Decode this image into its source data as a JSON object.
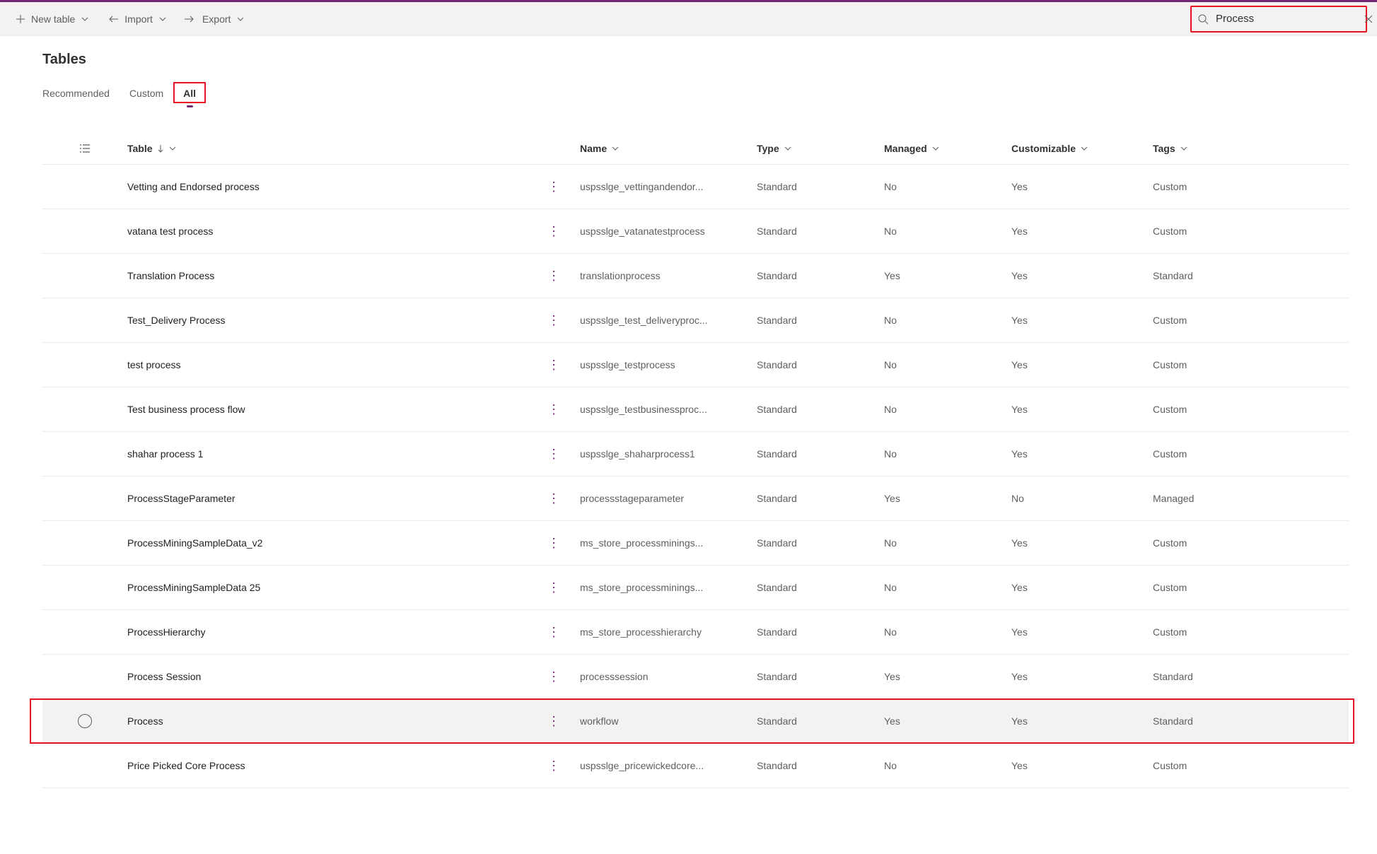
{
  "toolbar": {
    "new_table": "New table",
    "import": "Import",
    "export": "Export"
  },
  "search": {
    "value": "Process"
  },
  "page_title": "Tables",
  "tabs": [
    {
      "label": "Recommended",
      "active": false
    },
    {
      "label": "Custom",
      "active": false
    },
    {
      "label": "All",
      "active": true
    }
  ],
  "columns": {
    "table": "Table",
    "name": "Name",
    "type": "Type",
    "managed": "Managed",
    "customizable": "Customizable",
    "tags": "Tags"
  },
  "rows": [
    {
      "table": "Vetting and Endorsed process",
      "name": "uspsslge_vettingandendor...",
      "type": "Standard",
      "managed": "No",
      "customizable": "Yes",
      "tags": "Custom",
      "highlight": false,
      "selected": false
    },
    {
      "table": "vatana test process",
      "name": "uspsslge_vatanatestprocess",
      "type": "Standard",
      "managed": "No",
      "customizable": "Yes",
      "tags": "Custom",
      "highlight": false,
      "selected": false
    },
    {
      "table": "Translation Process",
      "name": "translationprocess",
      "type": "Standard",
      "managed": "Yes",
      "customizable": "Yes",
      "tags": "Standard",
      "highlight": false,
      "selected": false
    },
    {
      "table": "Test_Delivery Process",
      "name": "uspsslge_test_deliveryproc...",
      "type": "Standard",
      "managed": "No",
      "customizable": "Yes",
      "tags": "Custom",
      "highlight": false,
      "selected": false
    },
    {
      "table": "test process",
      "name": "uspsslge_testprocess",
      "type": "Standard",
      "managed": "No",
      "customizable": "Yes",
      "tags": "Custom",
      "highlight": false,
      "selected": false
    },
    {
      "table": "Test business process flow",
      "name": "uspsslge_testbusinessproc...",
      "type": "Standard",
      "managed": "No",
      "customizable": "Yes",
      "tags": "Custom",
      "highlight": false,
      "selected": false
    },
    {
      "table": "shahar process 1",
      "name": "uspsslge_shaharprocess1",
      "type": "Standard",
      "managed": "No",
      "customizable": "Yes",
      "tags": "Custom",
      "highlight": false,
      "selected": false
    },
    {
      "table": "ProcessStageParameter",
      "name": "processstageparameter",
      "type": "Standard",
      "managed": "Yes",
      "customizable": "No",
      "tags": "Managed",
      "highlight": false,
      "selected": false
    },
    {
      "table": "ProcessMiningSampleData_v2",
      "name": "ms_store_processminings...",
      "type": "Standard",
      "managed": "No",
      "customizable": "Yes",
      "tags": "Custom",
      "highlight": false,
      "selected": false
    },
    {
      "table": "ProcessMiningSampleData 25",
      "name": "ms_store_processminings...",
      "type": "Standard",
      "managed": "No",
      "customizable": "Yes",
      "tags": "Custom",
      "highlight": false,
      "selected": false
    },
    {
      "table": "ProcessHierarchy",
      "name": "ms_store_processhierarchy",
      "type": "Standard",
      "managed": "No",
      "customizable": "Yes",
      "tags": "Custom",
      "highlight": false,
      "selected": false
    },
    {
      "table": "Process Session",
      "name": "processsession",
      "type": "Standard",
      "managed": "Yes",
      "customizable": "Yes",
      "tags": "Standard",
      "highlight": false,
      "selected": false
    },
    {
      "table": "Process",
      "name": "workflow",
      "type": "Standard",
      "managed": "Yes",
      "customizable": "Yes",
      "tags": "Standard",
      "highlight": true,
      "selected": true
    },
    {
      "table": "Price Picked Core Process",
      "name": "uspsslge_pricewickedcore...",
      "type": "Standard",
      "managed": "No",
      "customizable": "Yes",
      "tags": "Custom",
      "highlight": false,
      "selected": false
    }
  ]
}
